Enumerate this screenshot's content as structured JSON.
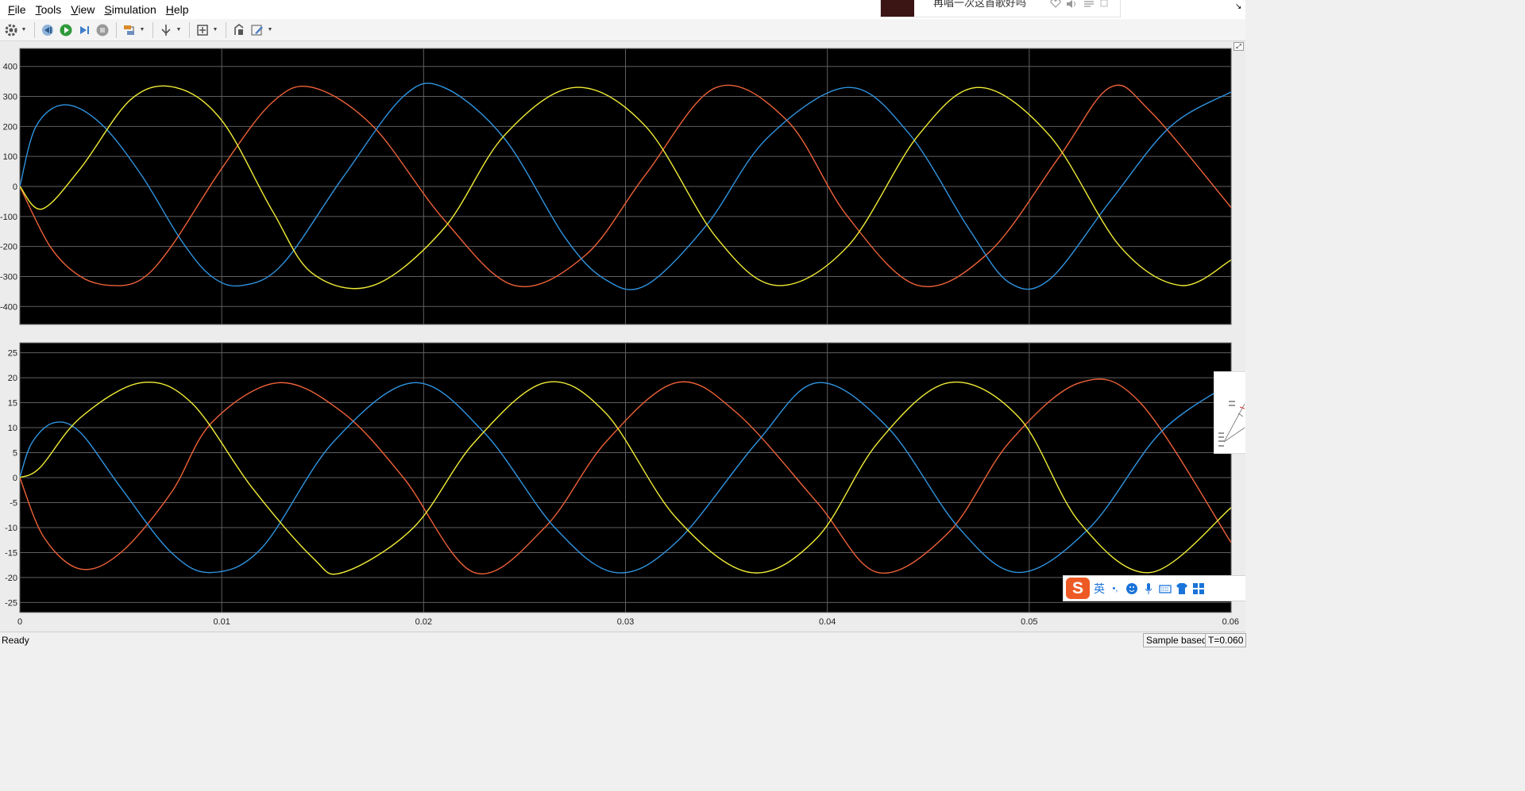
{
  "menubar": {
    "items": [
      {
        "label": "File",
        "key": "F"
      },
      {
        "label": "Tools",
        "key": "T"
      },
      {
        "label": "View",
        "key": "V"
      },
      {
        "label": "Simulation",
        "key": "S"
      },
      {
        "label": "Help",
        "key": "H"
      }
    ]
  },
  "toolbar": {
    "buttons": [
      "settings-icon",
      "step-back-icon",
      "run-icon",
      "step-forward-icon",
      "stop-icon",
      "highlight-icon",
      "cursor-measure-icon",
      "zoom-fit-icon",
      "restore-style-icon",
      "edit-style-icon"
    ]
  },
  "notification": {
    "text": "再唱一次这首歌好吗"
  },
  "colors": {
    "plot_bg": "#000000",
    "grid": "#5f5f5f",
    "axis_text": "#ffffff",
    "series_red": "#ee6138",
    "series_blue": "#2f94e0",
    "series_yellow": "#f2ed36"
  },
  "chart_data": [
    {
      "type": "line",
      "title": "",
      "xlabel": "",
      "ylabel": "",
      "xlim": [
        0,
        0.06
      ],
      "ylim": [
        -460,
        460
      ],
      "yticks": [
        -400,
        -300,
        -200,
        -100,
        0,
        100,
        200,
        300,
        400
      ],
      "xticks": [
        0,
        0.01,
        0.02,
        0.03,
        0.04,
        0.05,
        0.06
      ],
      "grid": true,
      "series": [
        {
          "color": "red",
          "x": [
            0,
            0.0015,
            0.003,
            0.0045,
            0.006,
            0.0075,
            0.01,
            0.0125,
            0.0145,
            0.0175,
            0.021,
            0.0245,
            0.028,
            0.031,
            0.0345,
            0.038,
            0.041,
            0.0445,
            0.048,
            0.0515,
            0.054,
            0.056,
            0.06
          ],
          "y": [
            0,
            -200,
            -300,
            -330,
            -310,
            -200,
            60,
            280,
            330,
            200,
            -110,
            -330,
            -230,
            40,
            330,
            220,
            -100,
            -330,
            -220,
            100,
            330,
            250,
            -70
          ]
        },
        {
          "color": "blue",
          "x": [
            0,
            0.0008,
            0.0022,
            0.004,
            0.006,
            0.008,
            0.0095,
            0.011,
            0.013,
            0.016,
            0.019,
            0.021,
            0.024,
            0.027,
            0.029,
            0.031,
            0.034,
            0.037,
            0.041,
            0.044,
            0.047,
            0.049,
            0.051,
            0.054,
            0.057,
            0.06
          ],
          "y": [
            0,
            200,
            272,
            210,
            40,
            -180,
            -300,
            -330,
            -260,
            30,
            300,
            330,
            160,
            -170,
            -310,
            -330,
            -130,
            160,
            330,
            180,
            -140,
            -320,
            -310,
            -50,
            200,
            315
          ]
        },
        {
          "color": "yellow",
          "x": [
            0,
            0.0011,
            0.003,
            0.0055,
            0.0077,
            0.01,
            0.0125,
            0.0145,
            0.0175,
            0.021,
            0.024,
            0.0275,
            0.031,
            0.0345,
            0.0375,
            0.041,
            0.0445,
            0.0475,
            0.051,
            0.0545,
            0.0575,
            0.06
          ],
          "y": [
            0,
            -75,
            60,
            290,
            330,
            220,
            -80,
            -290,
            -330,
            -140,
            170,
            330,
            200,
            -170,
            -330,
            -200,
            170,
            330,
            170,
            -200,
            -330,
            -245
          ]
        }
      ]
    },
    {
      "type": "line",
      "title": "",
      "xlabel": "",
      "ylabel": "",
      "xlim": [
        0,
        0.06
      ],
      "ylim": [
        -27,
        27
      ],
      "yticks": [
        -25,
        -20,
        -15,
        -10,
        -5,
        0,
        5,
        10,
        15,
        20,
        25
      ],
      "xticks": [
        0,
        0.01,
        0.02,
        0.03,
        0.04,
        0.05,
        0.06
      ],
      "xticklabels": [
        "0",
        "0.01",
        "0.02",
        "0.03",
        "0.04",
        "0.05",
        "0.06"
      ],
      "grid": true,
      "series": [
        {
          "color": "red",
          "x": [
            0,
            0.0012,
            0.003,
            0.005,
            0.0075,
            0.0095,
            0.0128,
            0.016,
            0.019,
            0.0225,
            0.026,
            0.029,
            0.0325,
            0.0355,
            0.0395,
            0.0425,
            0.046,
            0.049,
            0.0525,
            0.0555,
            0.06
          ],
          "y": [
            0,
            -12,
            -18.3,
            -15,
            -3,
            11,
            19,
            13,
            0,
            -19,
            -10,
            7,
            19,
            13,
            -5,
            -19,
            -11,
            7,
            19,
            15,
            -13
          ]
        },
        {
          "color": "blue",
          "x": [
            0,
            0.0006,
            0.0017,
            0.003,
            0.005,
            0.0075,
            0.0095,
            0.012,
            0.0155,
            0.0195,
            0.023,
            0.0265,
            0.0295,
            0.0325,
            0.0365,
            0.0395,
            0.043,
            0.0465,
            0.0495,
            0.053,
            0.0565,
            0.06
          ],
          "y": [
            0,
            7,
            11,
            9,
            -2,
            -15,
            -19,
            -14,
            7,
            19,
            9,
            -10,
            -19,
            -13,
            7,
            19,
            10,
            -10,
            -19,
            -10,
            9,
            19
          ]
        },
        {
          "color": "yellow",
          "x": [
            0,
            0.001,
            0.003,
            0.006,
            0.0085,
            0.0115,
            0.0145,
            0.016,
            0.0195,
            0.0225,
            0.026,
            0.029,
            0.0325,
            0.0362,
            0.0395,
            0.0425,
            0.046,
            0.0495,
            0.0525,
            0.056,
            0.06
          ],
          "y": [
            0,
            2,
            12,
            19,
            15,
            -2,
            -16,
            -19,
            -10,
            7,
            19,
            13,
            -8,
            -19,
            -12,
            7,
            19,
            12,
            -9,
            -19,
            -6
          ]
        }
      ]
    }
  ],
  "status": {
    "left": "Ready",
    "mode": "Sample based",
    "time": "T=0.060"
  },
  "ime": {
    "logo": "S",
    "lang": "英",
    "punct": "•,"
  }
}
